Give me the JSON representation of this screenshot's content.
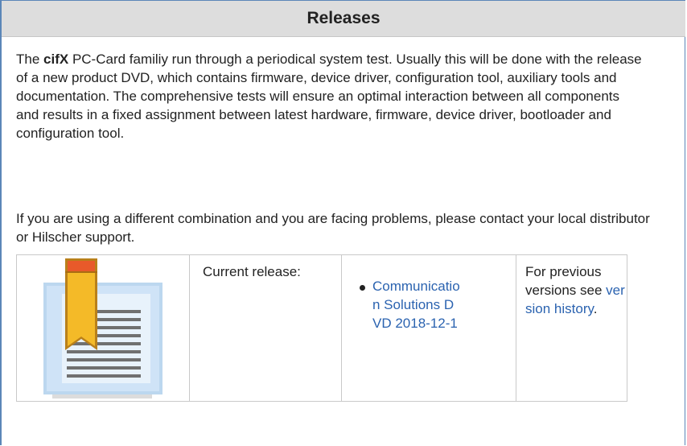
{
  "panel": {
    "title": "Releases"
  },
  "intro": {
    "prefix": "The ",
    "product": "cifX",
    "text": " PC-Card familiy run through a periodical system test. Usually this will be done with the release of a new product DVD, which contains firmware, device driver, configuration tool, auxiliary tools and documentation. The comprehensive tests will ensure an optimal interaction between all components and results in a fixed assignment between latest hardware, firmware, device driver, bootloader and configuration tool."
  },
  "contact": {
    "text": "If you are using a different combination and you are facing problems, please contact your local distributor or Hilscher support."
  },
  "release_table": {
    "icon": "bookmark-document-icon",
    "current_label": "Current release:",
    "releases": [
      {
        "label": "Communication Solutions DVD 2018-12-1"
      }
    ],
    "previous": {
      "prefix": "For previous versions see ",
      "link_text": "version history",
      "suffix": "."
    }
  },
  "colors": {
    "accent": "#5b86b8",
    "link": "#2b63b0",
    "header_bg": "#dddddd"
  }
}
